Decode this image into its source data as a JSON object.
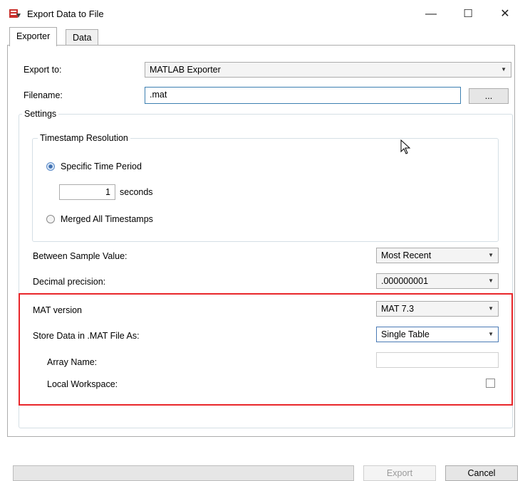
{
  "window": {
    "title": "Export Data to File",
    "icon": "export-matlab-icon",
    "controls": {
      "minimize": "—",
      "maximize": "☐",
      "close": "✕"
    }
  },
  "tabs": [
    {
      "label": "Exporter",
      "active": true
    },
    {
      "label": "Data",
      "active": false
    }
  ],
  "exporter": {
    "export_to_label": "Export to:",
    "export_to_value": "MATLAB Exporter",
    "filename_label": "Filename:",
    "filename_value": ".mat",
    "browse_label": "..."
  },
  "settings": {
    "legend": "Settings",
    "timestamp": {
      "legend": "Timestamp Resolution",
      "specific_label": "Specific Time Period",
      "specific_checked": true,
      "period_value": "1",
      "period_unit": "seconds",
      "merged_label": "Merged All Timestamps",
      "merged_checked": false
    },
    "between_sample_label": "Between Sample Value:",
    "between_sample_value": "Most Recent",
    "decimal_label": "Decimal precision:",
    "decimal_value": ".000000001",
    "mat_version_label": "MAT version",
    "mat_version_value": "MAT 7.3",
    "store_as_label": "Store Data in .MAT File As:",
    "store_as_value": "Single Table",
    "array_name_label": "Array Name:",
    "array_name_value": "",
    "local_ws_label": "Local Workspace:",
    "local_ws_checked": false
  },
  "footer": {
    "export_label": "Export",
    "cancel_label": "Cancel"
  },
  "colors": {
    "highlight": "#e8262a",
    "accent": "#3c7fb1"
  }
}
